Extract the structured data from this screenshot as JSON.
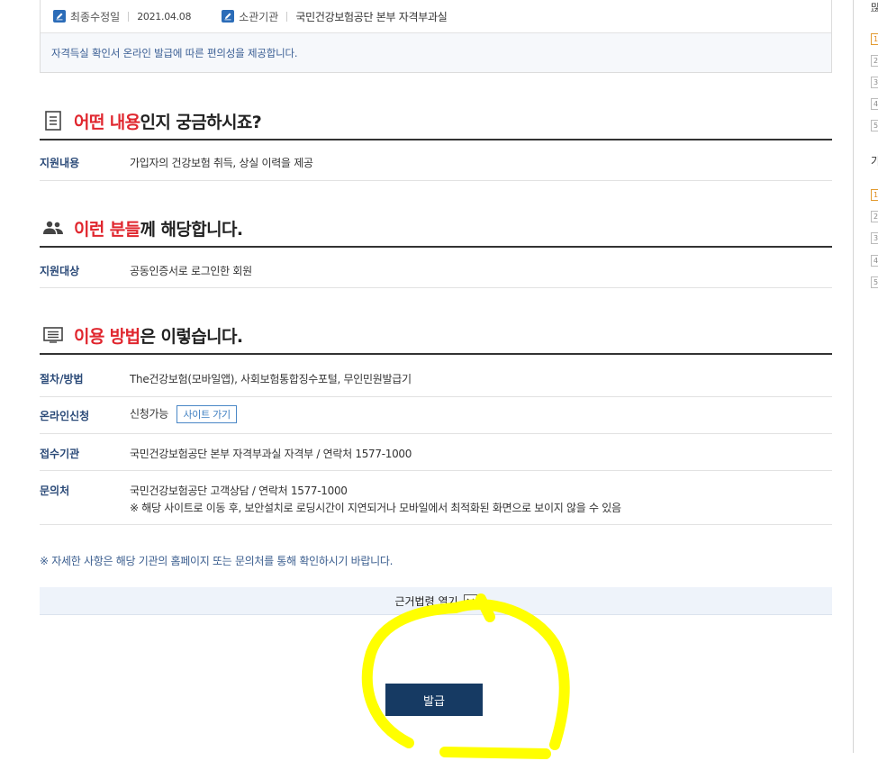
{
  "meta": {
    "last_modified_label": "최종수정일",
    "last_modified_value": "2021.04.08",
    "agency_label": "소관기관",
    "agency_value": "국민건강보험공단 본부 자격부과실"
  },
  "summary": "자격득실 확인서 온라인 발급에 따른 편의성을 제공합니다.",
  "sections": {
    "content": {
      "title_highlight": "어떤 내용",
      "title_rest": "인지 궁금하시죠?",
      "rows": [
        {
          "label": "지원내용",
          "value": "가입자의 건강보험 취득, 상실 이력을 제공"
        }
      ]
    },
    "target": {
      "title_highlight": "이런 분들",
      "title_rest": "께 해당합니다.",
      "rows": [
        {
          "label": "지원대상",
          "value": "공동인증서로 로그인한 회원"
        }
      ]
    },
    "method": {
      "title_highlight": "이용 방법",
      "title_rest": "은 이렇습니다.",
      "procedure_label": "절차/방법",
      "procedure_value": "The건강보험(모바일앱), 사회보험통합징수포털, 무인민원발급기",
      "online_label": "온라인신청",
      "online_value": "신청가능",
      "site_button": "사이트 가기",
      "reception_label": "접수기관",
      "reception_value": "국민건강보험공단 본부 자격부과실 자격부 / 연락처 1577-1000",
      "inquiry_label": "문의처",
      "inquiry_value": "국민건강보험공단 고객상담 / 연락처 1577-1000",
      "inquiry_note": "※ 해당 사이트로 이동 후, 보안설치로 로딩시간이 지연되거나 모바일에서 최적화된 화면으로 보이지 않을 수 있음"
    }
  },
  "notice": "※ 자세한 사항은 해당 기관의 홈페이지 또는 문의처를 통해 확인하시기 바랍니다.",
  "law_toggle_label": "근거법령 열기",
  "issue_button": "발급",
  "sidebar": {
    "heading_1": "많",
    "heading_2": "가",
    "ranks_1": [
      "1",
      "2",
      "3",
      "4",
      "5"
    ],
    "ranks_2": [
      "1",
      "2",
      "3",
      "4",
      "5"
    ]
  },
  "colors": {
    "highlight_text": "#e0262e",
    "label_text": "#2b4a78",
    "button_bg": "#163a63",
    "annotation": "#ffff00"
  }
}
